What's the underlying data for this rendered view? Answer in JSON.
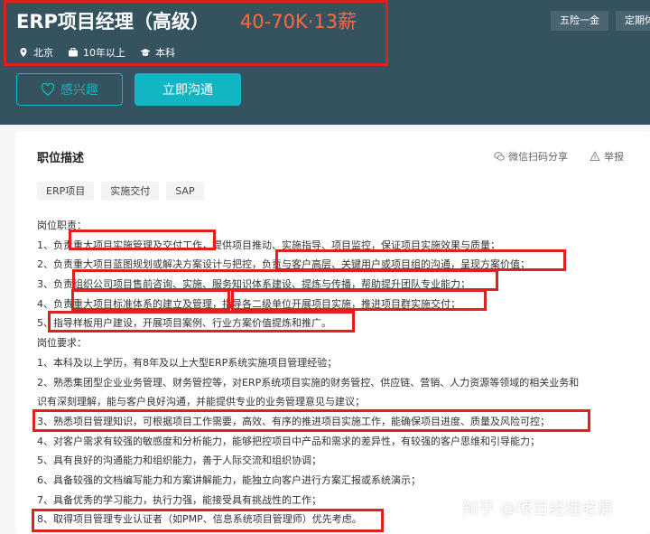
{
  "header": {
    "job_title": "ERP项目经理（高级）",
    "salary": "40-70K·13薪",
    "location": "北京",
    "experience": "10年以上",
    "education": "本科",
    "benefits": [
      "五险一金",
      "定期体检"
    ]
  },
  "actions": {
    "interest_label": "感兴趣",
    "chat_label": "立即沟通"
  },
  "card": {
    "title": "职位描述",
    "share_label": "微信扫码分享",
    "report_label": "举报",
    "tags": [
      "ERP项目",
      "实施交付",
      "SAP"
    ]
  },
  "description": {
    "lines": [
      "岗位职责：",
      "1、负责重大项目实施管理及交付工作，提供项目推动、实施指导、项目监控，保证项目实施效果与质量；",
      "2、负责重大项目蓝图规划或解决方案设计与把控，负责与客户高层、关键用户或项目组的沟通，呈现方案价值；",
      "3、负责组织公司项目售前咨询、实施、服务知识体系建设、提炼与传播，帮助提升团队专业能力；",
      "4、负责重大项目标准体系的建立及管理，指导各二级单位开展项目实施，推进项目群实施交付；",
      "5、指导样板用户建设，开展项目案例、行业方案价值提炼和推广。",
      "岗位要求：",
      "1、本科及以上学历，有8年及以上大型ERP系统实施项目管理经验；",
      "2、熟悉集团型企业业务管理、财务管控等，对ERP系统项目实施的财务管控、供应链、营销、人力资源等领域的相关业务和",
      "识有深刻理解，能与客户良好沟通，并能提供专业的业务管理意见与建议；",
      "3、熟悉项目管理知识，可根据项目工作需要，高效、有序的推进项目实施工作，能确保项目进度、质量及风险可控；",
      "4、对客户需求有较强的敏感度和分析能力，能够把控项目中产品和需求的差异性，有较强的客户思维和引导能力；",
      "5、具有良好的沟通能力和组织能力，善于人际交流和组织协调；",
      "6、具备较强的文档编写能力和方案讲解能力，能独立向客户进行方案汇报或系统演示；",
      "7、具备优秀的学习能力，执行力强，能接受具有挑战性的工作；",
      "8、取得项目管理专业认证者（如PMP、信息系统项目管理师）优先考虑。"
    ]
  },
  "watermark": "知乎 @项目经理老原",
  "colors": {
    "header_bg": "#35525f",
    "accent": "#12b5c4",
    "salary": "#ff6b3d",
    "highlight": "#e0201c"
  }
}
